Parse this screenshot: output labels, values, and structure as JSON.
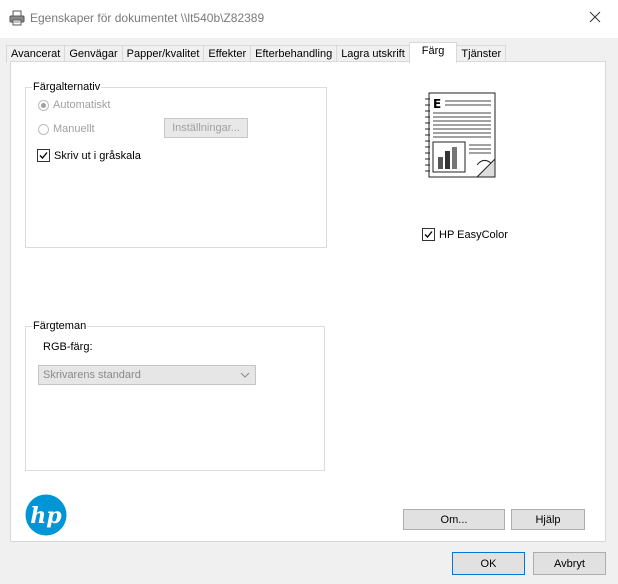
{
  "window": {
    "title": "Egenskaper för dokumentet \\\\lt540b\\Z82389",
    "close_icon": "close-icon"
  },
  "tabs": [
    {
      "label": "Avancerat"
    },
    {
      "label": "Genvägar"
    },
    {
      "label": "Papper/kvalitet"
    },
    {
      "label": "Effekter"
    },
    {
      "label": "Efterbehandling"
    },
    {
      "label": "Lagra utskrift"
    },
    {
      "label": "Färg",
      "active": true
    },
    {
      "label": "Tjänster"
    }
  ],
  "color_options": {
    "label": "Färgalternativ",
    "automatic_label": "Automatiskt",
    "manual_label": "Manuellt",
    "settings_button": "Inställningar...",
    "grayscale_label": "Skriv ut i gråskala"
  },
  "preview": {
    "icon": "document-preview-icon",
    "easycolor_label": "HP EasyColor"
  },
  "color_themes": {
    "label": "Färgteman",
    "rgb_label": "RGB-färg:",
    "rgb_value": "Skrivarens standard"
  },
  "bottom": {
    "about_button": "Om...",
    "help_button": "Hjälp",
    "logo_text": "hp"
  },
  "dialog": {
    "ok_button": "OK",
    "cancel_button": "Avbryt"
  }
}
